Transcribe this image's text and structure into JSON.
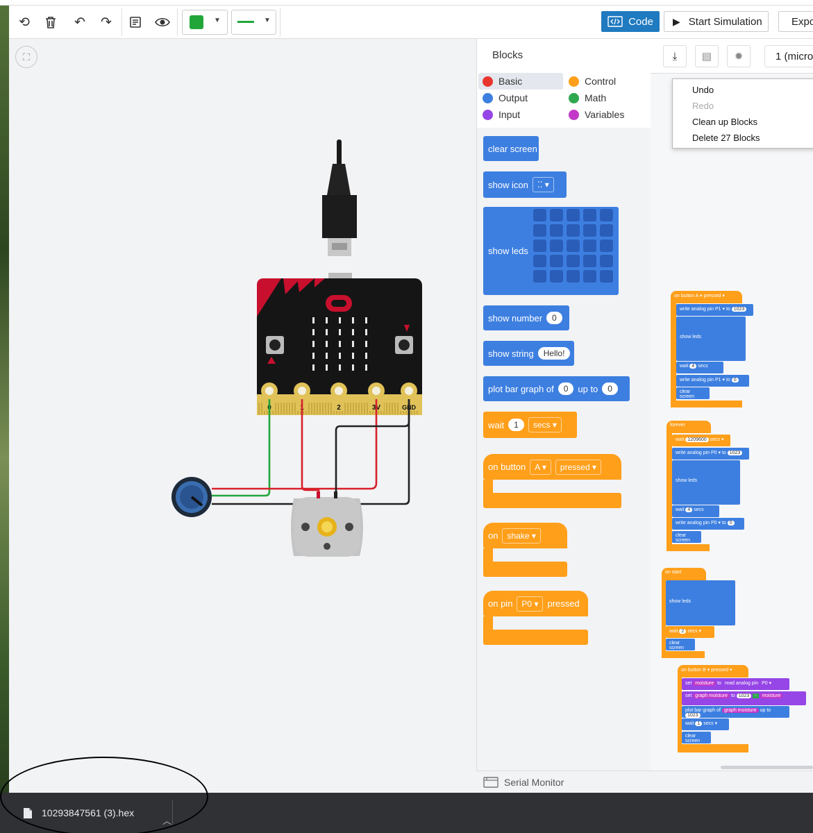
{
  "toolbar": {
    "code_label": "Code",
    "start_sim_label": "Start Simulation",
    "export_label": "Expo",
    "wire_color": "#22a63a"
  },
  "blocks_panel": {
    "title": "Blocks",
    "categories": [
      {
        "label": "Basic",
        "color": "#e8352e"
      },
      {
        "label": "Control",
        "color": "#ff9f1a"
      },
      {
        "label": "Output",
        "color": "#3d7fe0"
      },
      {
        "label": "Math",
        "color": "#2fa84f"
      },
      {
        "label": "Input",
        "color": "#9645e6"
      },
      {
        "label": "Variables",
        "color": "#c338c8"
      }
    ],
    "blocks": {
      "clear_screen": "clear screen",
      "show_icon": "show icon",
      "show_leds": "show leds",
      "show_number": "show number",
      "show_number_val": "0",
      "show_string": "show string",
      "show_string_val": "Hello!",
      "plot_bar": "plot bar graph of",
      "plot_bar_val": "0",
      "plot_bar_upto": "up to",
      "plot_bar_upto_val": "0",
      "wait": "wait",
      "wait_val": "1",
      "wait_unit": "secs",
      "on_button": "on button",
      "on_button_btn": "A",
      "on_button_evt": "pressed",
      "on": "on",
      "on_shake": "shake",
      "on_pin": "on pin",
      "on_pin_pin": "P0",
      "on_pin_evt": "pressed"
    }
  },
  "context_menu": {
    "items": [
      {
        "label": "Undo",
        "enabled": true
      },
      {
        "label": "Redo",
        "enabled": false
      },
      {
        "label": "Clean up Blocks",
        "enabled": true
      },
      {
        "label": "Delete 27 Blocks",
        "enabled": true
      }
    ]
  },
  "workspace": {
    "device_select": "1 (micro",
    "scripts": {
      "s1_hat": "on button",
      "s1_btn": "A",
      "s1_evt": "pressed",
      "s1_l1": "write analog pin",
      "s1_pin": "P1",
      "s1_to": "to",
      "s1_val": "1023",
      "s1_leds": "show leds",
      "s1_wait": "wait",
      "s1_wait_val": "4",
      "s1_secs": "secs",
      "s1_l2": "write analog pin",
      "s1_pin2": "P1",
      "s1_val2": "0",
      "s1_clear": "clear screen",
      "s2_hat": "forever",
      "s2_wait": "wait",
      "s2_wait_val": "1209600",
      "s2_secs": "secs",
      "s2_l1": "write analog pin",
      "s2_pin": "P0",
      "s2_val": "1023",
      "s2_leds": "show leds",
      "s2_wait2": "wait",
      "s2_wait2_val": "4",
      "s2_l2": "write analog pin",
      "s2_val2": "0",
      "s2_clear": "clear screen",
      "s3_hat": "on start",
      "s3_leds": "show leds",
      "s3_wait": "wait",
      "s3_wait_val": "2",
      "s3_secs": "secs",
      "s3_clear": "clear screen",
      "s4_hat": "on button",
      "s4_btn": "B",
      "s4_evt": "pressed",
      "s4_set": "set",
      "s4_var1": "moisture",
      "s4_to": "to",
      "s4_read": "read analog pin",
      "s4_pin": "P0",
      "s4_var2": "graph moisture",
      "s4_val": "1023",
      "s4_op": "-",
      "s4_var1b": "moisture",
      "s4_plot": "plot bar graph of",
      "s4_upto": "up to",
      "s4_upto_val": "1023",
      "s4_wait": "wait",
      "s4_wait_val": "1",
      "s4_secs": "secs",
      "s4_clear": "clear screen"
    }
  },
  "circuit": {
    "pins": [
      "0",
      "1",
      "2",
      "3V",
      "GND"
    ]
  },
  "serial_monitor": {
    "label": "Serial Monitor"
  },
  "download_bar": {
    "filename": "10293847561 (3).hex"
  }
}
